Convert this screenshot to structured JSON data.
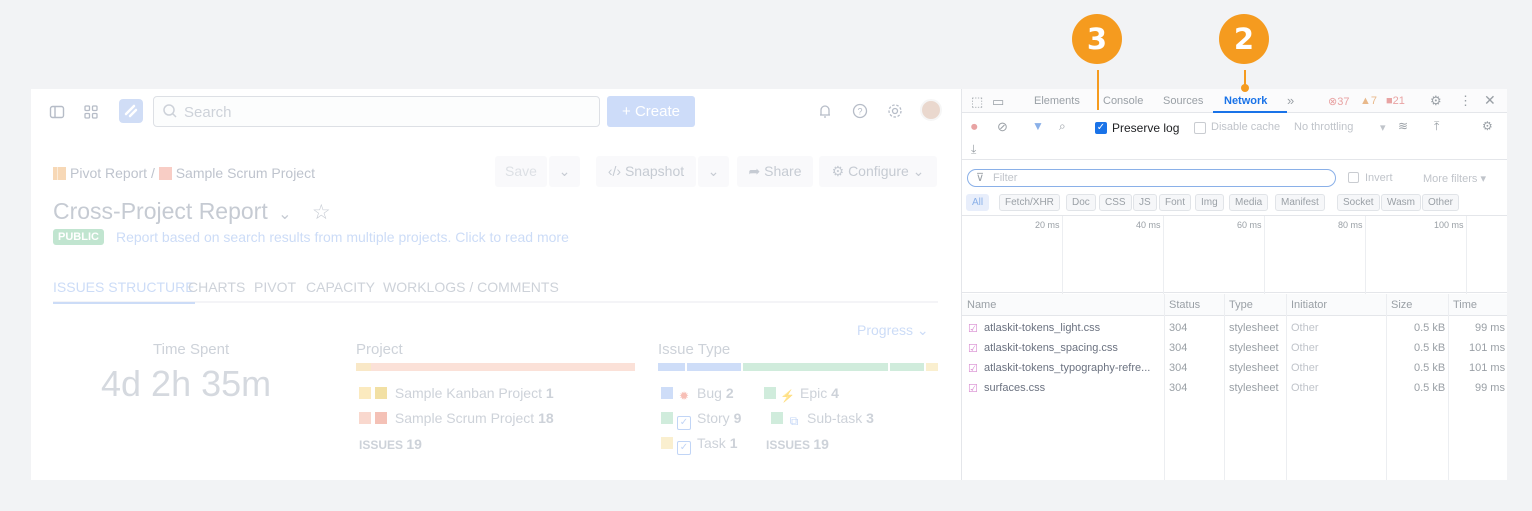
{
  "jira": {
    "search_placeholder": "Search",
    "create_label": "+ Create",
    "breadcrumb": {
      "pivot": "Pivot Report",
      "sep": "/",
      "project": "Sample Scrum Project"
    },
    "toolbar": {
      "save": "Save",
      "snapshot": "Snapshot",
      "share": "Share",
      "configure": "Configure"
    },
    "title": "Cross-Project Report",
    "badge": "PUBLIC",
    "description": "Report based on search results from multiple projects. Click to read more",
    "tabs": [
      "ISSUES STRUCTURE",
      "CHARTS",
      "PIVOT",
      "CAPACITY",
      "WORKLOGS / COMMENTS"
    ],
    "progress_label": "Progress",
    "time_spent": {
      "label": "Time Spent",
      "value": "4d 2h 35m"
    },
    "project": {
      "label": "Project",
      "items": [
        {
          "name": "Sample Kanban Project",
          "count": "1"
        },
        {
          "name": "Sample Scrum Project",
          "count": "18"
        }
      ],
      "issues_label": "ISSUES",
      "issues_total": "19"
    },
    "issue_type": {
      "label": "Issue Type",
      "items": [
        {
          "name": "Bug",
          "count": "2"
        },
        {
          "name": "Epic",
          "count": "4"
        },
        {
          "name": "Story",
          "count": "9"
        },
        {
          "name": "Sub-task",
          "count": "3"
        },
        {
          "name": "Task",
          "count": "1"
        }
      ],
      "issues_label": "ISSUES",
      "issues_total": "19"
    }
  },
  "devtools": {
    "tabs": [
      "Elements",
      "Console",
      "Sources",
      "Network"
    ],
    "active_tab": "Network",
    "errors": "37",
    "warnings": "7",
    "info": "21",
    "preserve_log": "Preserve log",
    "disable_cache": "Disable cache",
    "throttling": "No throttling",
    "filter_placeholder": "Filter",
    "invert": "Invert",
    "more_filters": "More filters",
    "type_filters": [
      "All",
      "Fetch/XHR",
      "Doc",
      "CSS",
      "JS",
      "Font",
      "Img",
      "Media",
      "Manifest",
      "Socket",
      "Wasm",
      "Other"
    ],
    "timeline_ticks": [
      "20 ms",
      "40 ms",
      "60 ms",
      "80 ms",
      "100 ms"
    ],
    "columns": [
      "Name",
      "Status",
      "Type",
      "Initiator",
      "Size",
      "Time"
    ],
    "requests": [
      {
        "name": "atlaskit-tokens_light.css",
        "status": "304",
        "type": "stylesheet",
        "initiator": "Other",
        "size": "0.5 kB",
        "time": "99 ms"
      },
      {
        "name": "atlaskit-tokens_spacing.css",
        "status": "304",
        "type": "stylesheet",
        "initiator": "Other",
        "size": "0.5 kB",
        "time": "101 ms"
      },
      {
        "name": "atlaskit-tokens_typography-refre...",
        "status": "304",
        "type": "stylesheet",
        "initiator": "Other",
        "size": "0.5 kB",
        "time": "101 ms"
      },
      {
        "name": "surfaces.css",
        "status": "304",
        "type": "stylesheet",
        "initiator": "Other",
        "size": "0.5 kB",
        "time": "99 ms"
      }
    ]
  },
  "callouts": {
    "a": "3",
    "b": "2"
  },
  "colors": {
    "accent": "#1a73e8",
    "callout": "#f59b1f",
    "badge": "#8fcfa9"
  }
}
